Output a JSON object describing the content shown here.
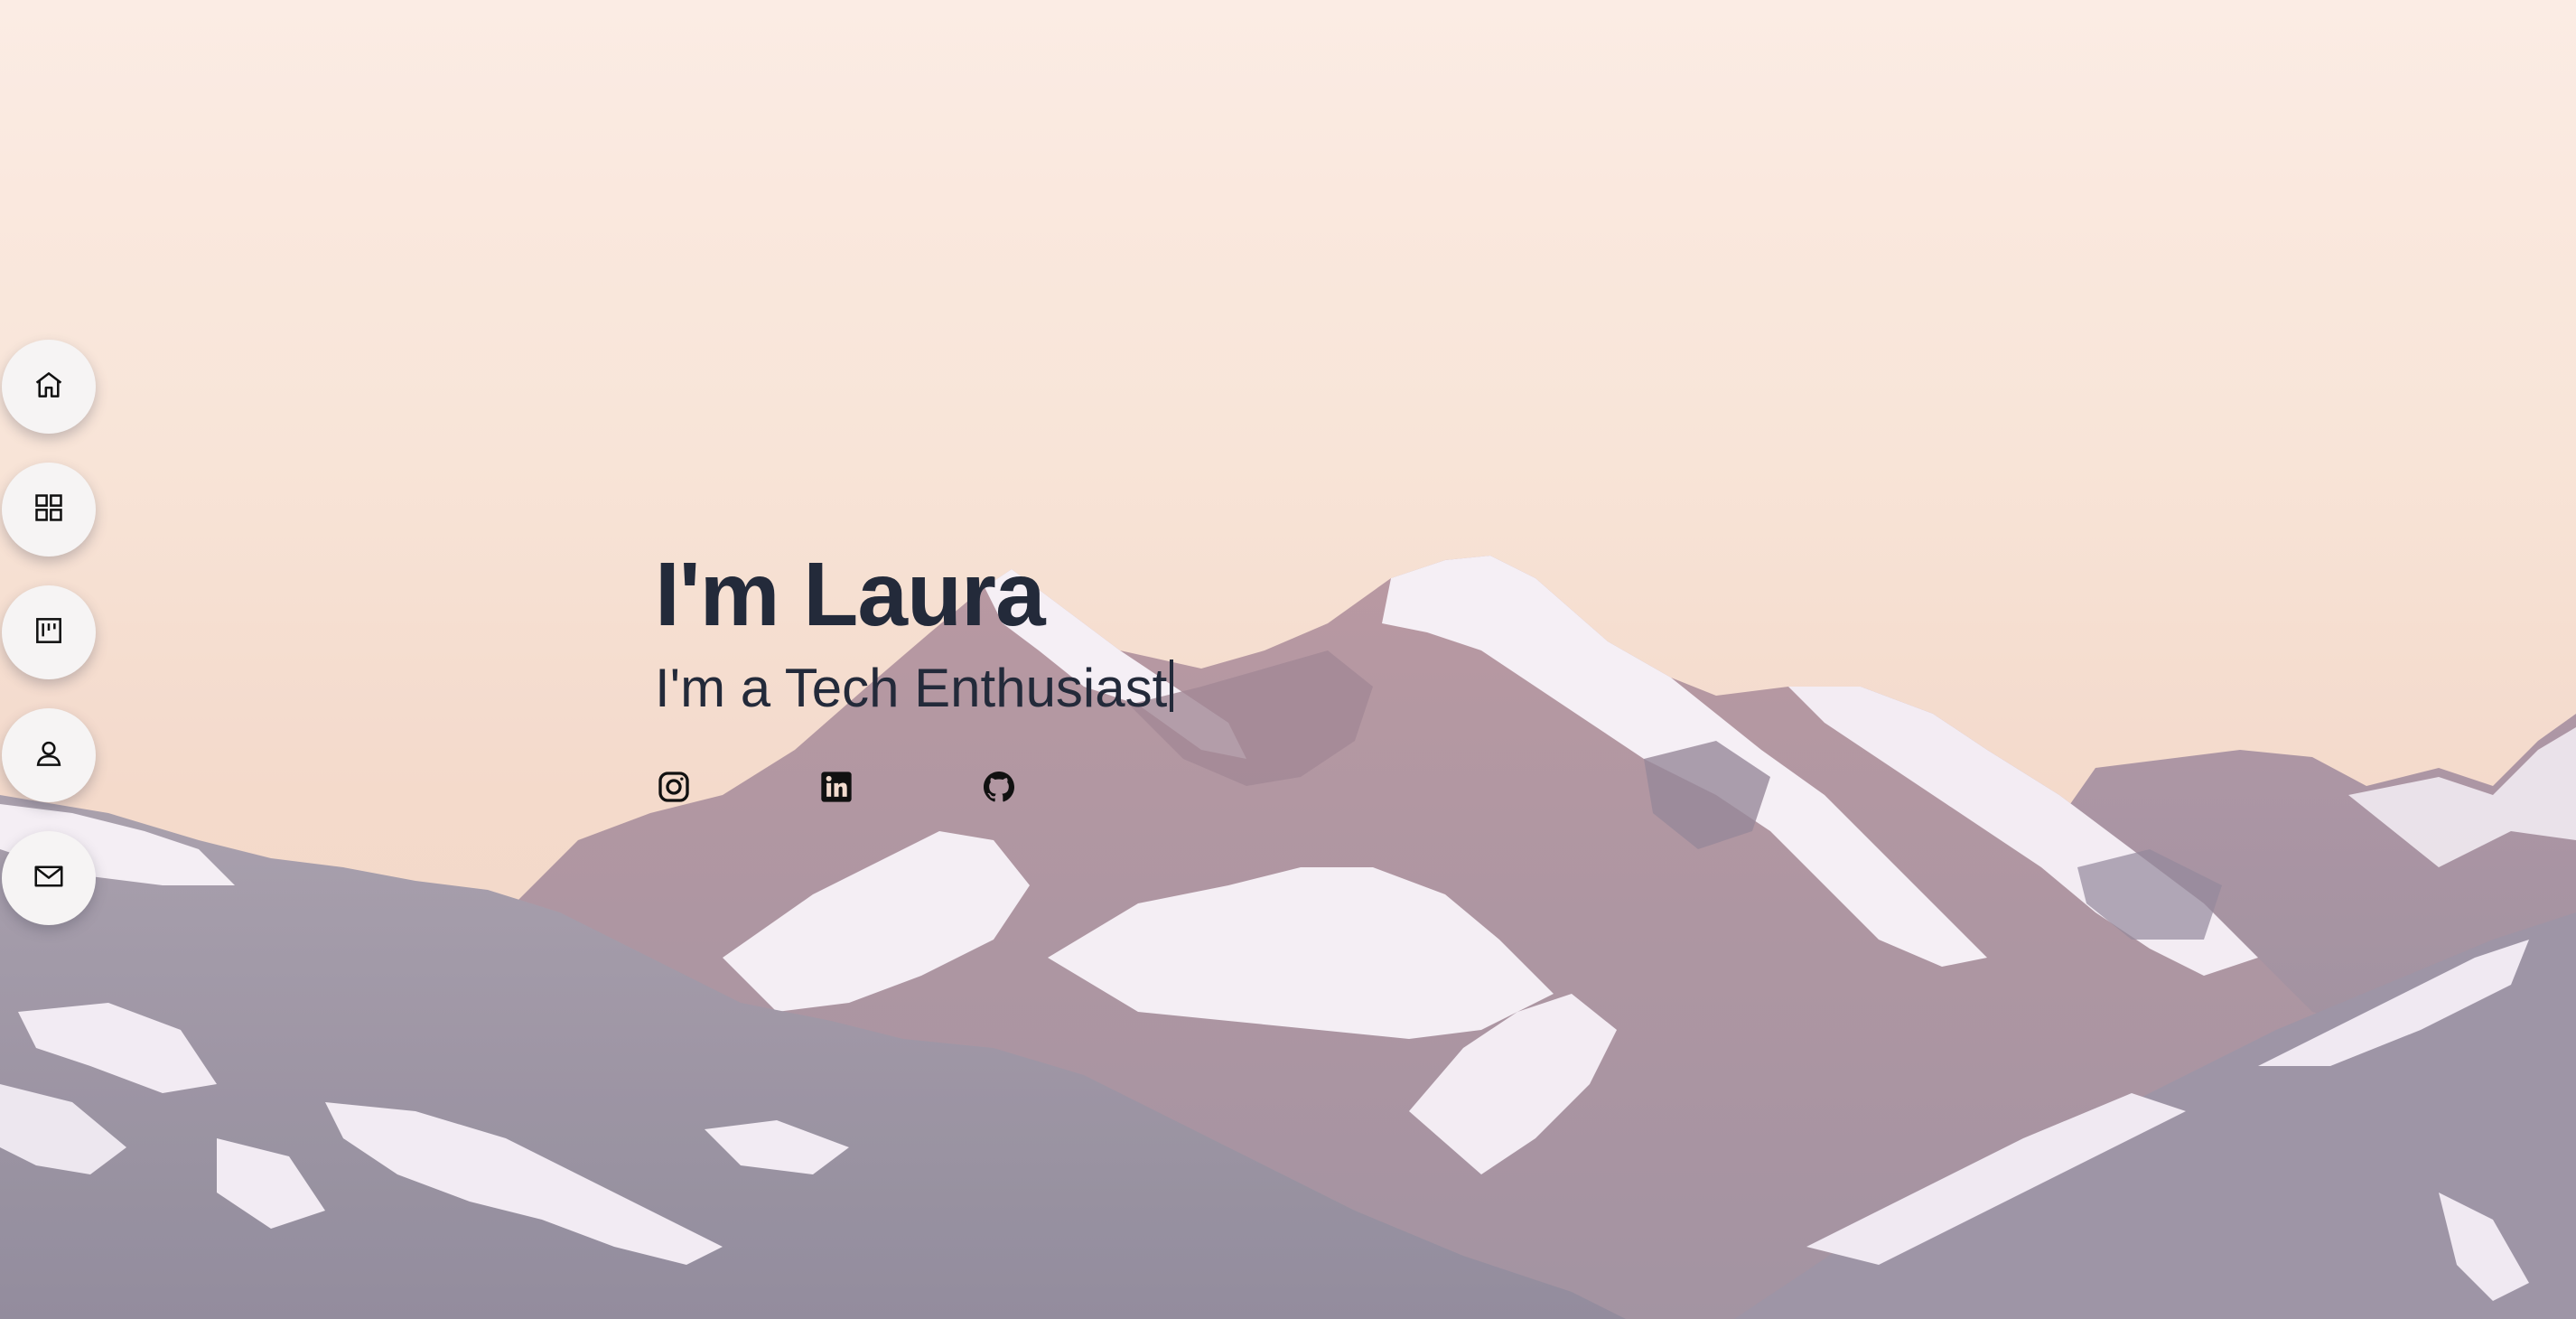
{
  "hero": {
    "title": "I'm Laura",
    "subtitle": "I'm a Tech Enthusiast"
  },
  "nav": [
    {
      "id": "home",
      "icon": "home-icon"
    },
    {
      "id": "portfolio",
      "icon": "grid-icon"
    },
    {
      "id": "projects",
      "icon": "board-icon"
    },
    {
      "id": "about",
      "icon": "person-icon"
    },
    {
      "id": "contact",
      "icon": "mail-icon"
    }
  ],
  "socials": [
    {
      "id": "instagram",
      "icon": "instagram-icon"
    },
    {
      "id": "linkedin",
      "icon": "linkedin-icon"
    },
    {
      "id": "github",
      "icon": "github-icon"
    }
  ],
  "colors": {
    "text": "#232a3a",
    "nav_bg": "#f6f4f4",
    "sky_top": "#fbece3",
    "sky_bottom": "#eed3c4",
    "snow": "#f4eef6",
    "rock": "#a2899a"
  }
}
